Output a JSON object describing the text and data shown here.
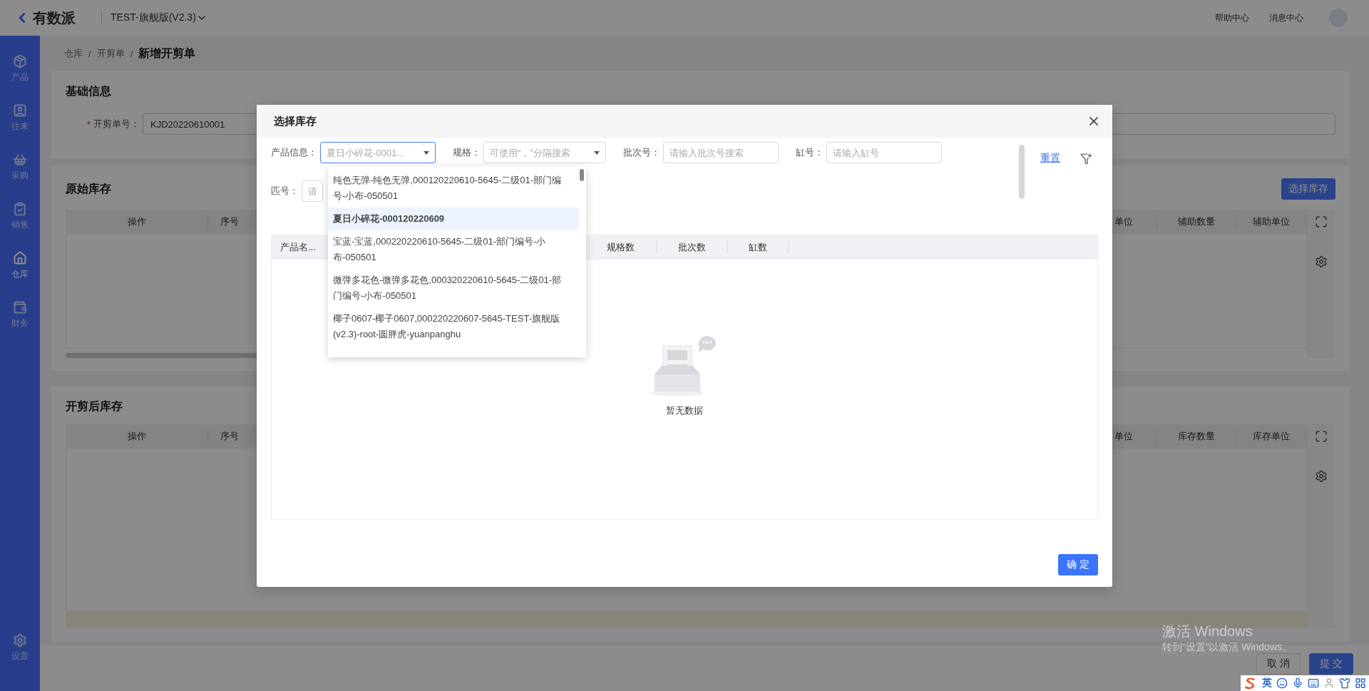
{
  "topbar": {
    "logo": "有数派",
    "workspace": "TEST-旗舰版(V2.3)",
    "links": [
      "帮助中心",
      "消息中心"
    ]
  },
  "sidebar": {
    "items": [
      {
        "label": "产品",
        "selected": false
      },
      {
        "label": "往来",
        "selected": false
      },
      {
        "label": "采购",
        "selected": false
      },
      {
        "label": "销售",
        "selected": false
      },
      {
        "label": "仓库",
        "selected": true
      },
      {
        "label": "财务",
        "selected": false
      }
    ],
    "settings": "设置"
  },
  "breadcrumb": {
    "items": [
      "仓库",
      "开剪单",
      "新增开剪单"
    ],
    "separators": [
      "/",
      "/"
    ]
  },
  "basic_info": {
    "title": "基础信息",
    "field": {
      "required_mark": "*",
      "label": "开剪单号：",
      "value": "KJD20220610001"
    }
  },
  "original_stock": {
    "title": "原始库存",
    "button": "选择库存",
    "columns_left": [
      "操作",
      "序号"
    ],
    "columns_right": [
      "单位",
      "辅助数量",
      "辅助单位"
    ]
  },
  "cut_stock": {
    "title": "开剪后库存",
    "columns_left": [
      "操作",
      "序号"
    ],
    "columns_right": [
      "单位",
      "库存数量",
      "库存单位"
    ]
  },
  "footer": {
    "buttons": [
      {
        "label": "取 消",
        "kind": "default"
      },
      {
        "label": "提 交",
        "kind": "primary"
      }
    ]
  },
  "modal": {
    "title": "选择库存",
    "filters": [
      {
        "label": "产品信息：",
        "kind": "select",
        "placeholder": "夏日小碎花-0001...",
        "focused": true
      },
      {
        "label": "规格：",
        "kind": "select",
        "placeholder": "可使用“，”分隔搜索",
        "focused": false
      },
      {
        "label": "批次号：",
        "kind": "input",
        "placeholder": "请输入批次号搜索",
        "focused": false
      },
      {
        "label": "缸号：",
        "kind": "input",
        "placeholder": "请输入缸号",
        "focused": false
      },
      {
        "label": "匹号：",
        "kind": "input",
        "placeholder": "请",
        "focused": false
      }
    ],
    "reset": "重置",
    "dropdown": [
      {
        "text": "纯色无弹-纯色无弹,000120220610-5645-二级01-部门编号-小布-050501",
        "selected": false
      },
      {
        "text": "夏日小碎花-000120220609",
        "selected": true
      },
      {
        "text": "宝蓝-宝蓝,000220220610-5645-二级01-部门编号-小布-050501",
        "selected": false
      },
      {
        "text": "微弹多花色-微弹多花色,000320220610-5645-二级01-部门编号-小布-050501",
        "selected": false
      },
      {
        "text": "椰子0607-椰子0607,000220220607-5645-TEST-旗舰版(v2.3)-root-圆胖虎-yuanpanghu",
        "selected": false
      }
    ],
    "table": {
      "columns": [
        "产品名...",
        "规格数",
        "批次数",
        "缸数"
      ],
      "empty": "暂无数据"
    },
    "confirm": "确 定"
  },
  "os_notice": [
    "激活 Windows",
    "转到“设置”以激活 Windows。"
  ],
  "ime_bar": {
    "mode": "英"
  }
}
